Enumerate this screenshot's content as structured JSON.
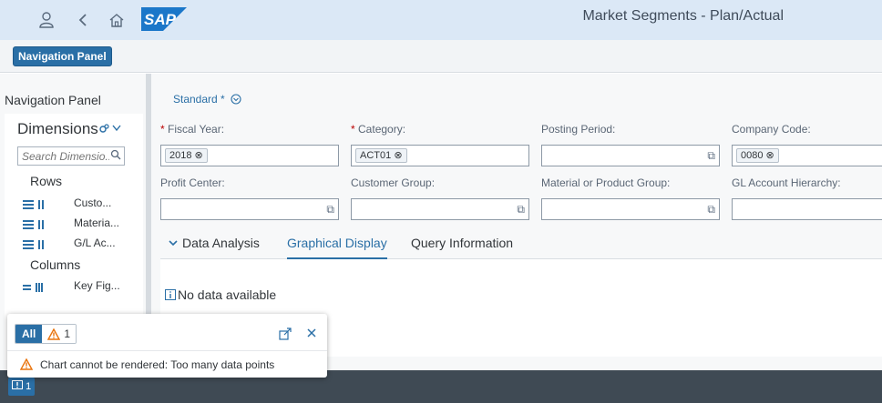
{
  "shell": {
    "title": "Market Segments - Plan/Actual",
    "logo_text": "SAP",
    "icons": [
      "user-icon",
      "back-icon",
      "home-icon"
    ]
  },
  "subbar": {
    "nav_button_label": "Navigation Panel"
  },
  "nav_panel": {
    "title": "Navigation Panel",
    "dimensions_label": "Dimensions",
    "search_placeholder": "Search Dimensio...",
    "rows_label": "Rows",
    "rows": [
      {
        "label": "Custo..."
      },
      {
        "label": "Materia..."
      },
      {
        "label": "G/L Ac..."
      }
    ],
    "columns_label": "Columns",
    "columns": [
      {
        "label": "Key Fig..."
      }
    ]
  },
  "filter": {
    "variant": "Standard *",
    "fields": [
      {
        "label": "Fiscal Year:",
        "required": true,
        "token": "2018"
      },
      {
        "label": "Category:",
        "required": true,
        "token": "ACT01"
      },
      {
        "label": "Posting Period:",
        "required": false,
        "token": ""
      },
      {
        "label": "Company Code:",
        "required": false,
        "token": "0080"
      },
      {
        "label": "Profit Center:",
        "required": false,
        "token": ""
      },
      {
        "label": "Customer Group:",
        "required": false,
        "token": ""
      },
      {
        "label": "Material or Product Group:",
        "required": false,
        "token": ""
      },
      {
        "label": "GL Account Hierarchy:",
        "required": false,
        "token": ""
      }
    ]
  },
  "tabs": {
    "items": [
      {
        "label": "Data Analysis"
      },
      {
        "label": "Graphical Display",
        "selected": true
      },
      {
        "label": "Query Information"
      }
    ]
  },
  "content": {
    "nodata_text": "No data available"
  },
  "messages": {
    "seg_all": "All",
    "warning_count": "1",
    "message": "Chart cannot be rendered: Too many data points",
    "footer_count": "1"
  },
  "colors": {
    "accent": "#2a6fa6",
    "shell": "#dbe8f6",
    "warning": "#e9730c"
  }
}
